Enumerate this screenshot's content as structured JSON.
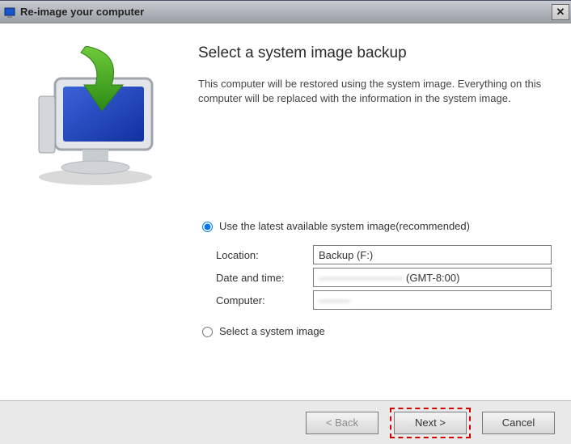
{
  "window": {
    "title": "Re-image your computer"
  },
  "page": {
    "heading": "Select a system image backup",
    "description": "This computer will be restored using the system image. Everything on this computer will be replaced with the information in the system image."
  },
  "options": {
    "useLatest": {
      "label": "Use the latest available system image(recommended)",
      "selected": true
    },
    "selectImage": {
      "label": "Select a system image",
      "selected": false
    }
  },
  "fields": {
    "location": {
      "label": "Location:",
      "value": "Backup (F:)"
    },
    "datetime": {
      "label": "Date and time:",
      "redacted": "————————",
      "suffix": "(GMT-8:00)"
    },
    "computer": {
      "label": "Computer:",
      "redacted": "———"
    }
  },
  "buttons": {
    "back": "< Back",
    "next": "Next >",
    "cancel": "Cancel"
  }
}
